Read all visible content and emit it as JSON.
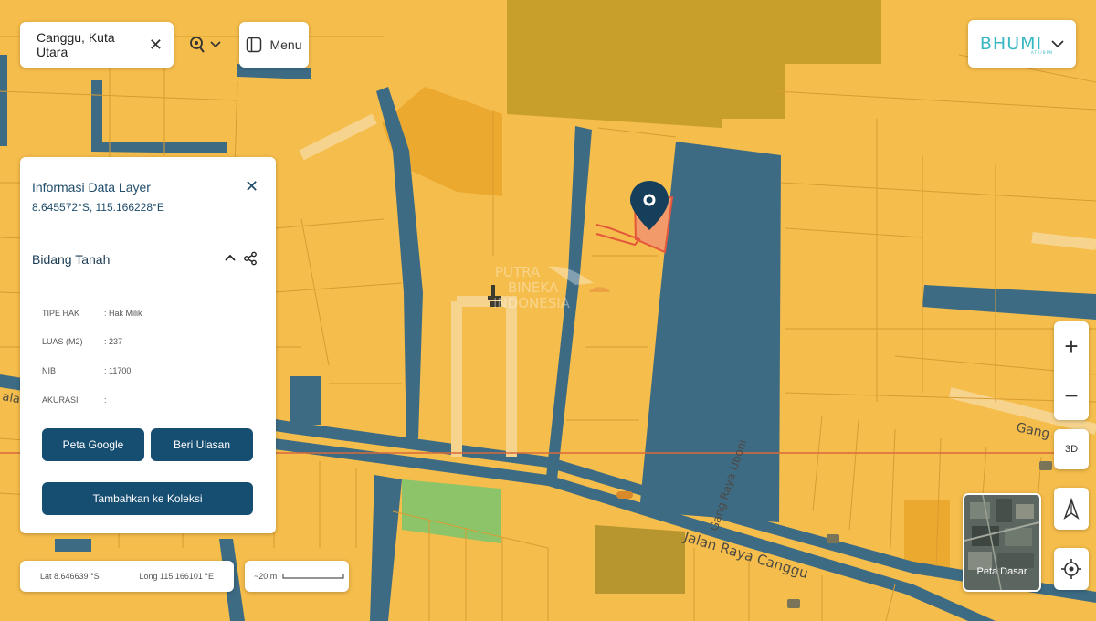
{
  "search": {
    "query": "Canggu, Kuta Utara",
    "clear_icon": "close-icon",
    "location_icon": "map-pin-search-icon"
  },
  "menu": {
    "label": "Menu",
    "icon": "sidebar-panel-icon"
  },
  "brand": {
    "logo_text": "BHUMI",
    "sub_text": "ATR/BPN"
  },
  "watermark": {
    "line1": "PUTRA",
    "line2": "BINEKA",
    "line3": "INDONESIA"
  },
  "map_labels": {
    "road_main": "Jalan Raya Canggu",
    "road_side": "Gang Raya Uboni",
    "road_right": "Gang R",
    "road_left": "ala"
  },
  "info_panel": {
    "title": "Informasi Data Layer",
    "coords": "8.645572°S, 115.166228°E",
    "section_title": "Bidang Tanah",
    "attributes": [
      {
        "key": "TIPE HAK",
        "value": ": Hak Milik"
      },
      {
        "key": "LUAS (M2)",
        "value": ": 237"
      },
      {
        "key": "NIB",
        "value": ": 11700"
      },
      {
        "key": "AKURASI",
        "value": ":"
      }
    ],
    "btn_google": "Peta Google",
    "btn_review": "Beri Ulasan",
    "btn_collection": "Tambahkan ke Koleksi"
  },
  "status_bar": {
    "lat": "Lat 8.646639 °S",
    "long": "Long 115.166101 °E",
    "scale": "~20 m"
  },
  "controls": {
    "zoom_in": "+",
    "zoom_out": "−",
    "three_d": "3D",
    "basemap_label": "Peta Dasar"
  },
  "colors": {
    "land": "#f5bd4b",
    "parcel_line": "#e5a93a",
    "water_blue": "#3d6b84",
    "panel_accent": "#164e72",
    "brand": "#39b8c4",
    "selected_parcel": "#f39a6a"
  }
}
